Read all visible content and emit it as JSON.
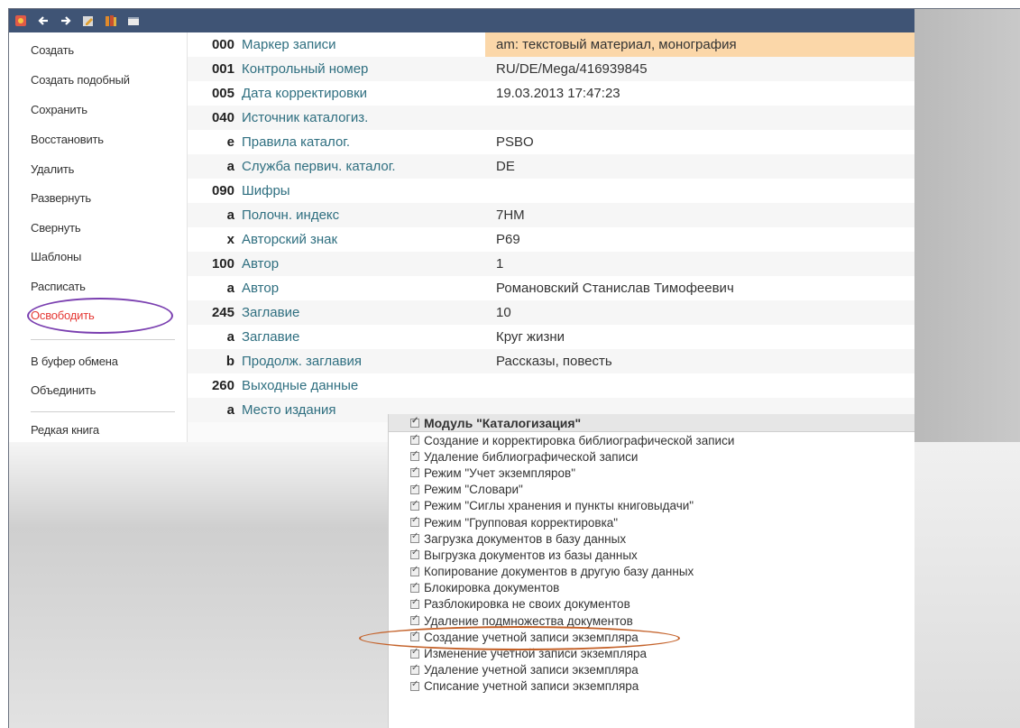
{
  "toolbar": {
    "icons": [
      "app-logo-icon",
      "back-arrow-icon",
      "forward-arrow-icon",
      "edit-icon",
      "books-icon",
      "window-icon"
    ]
  },
  "sidebar": {
    "items": [
      {
        "label": "Создать"
      },
      {
        "label": "Создать подобный"
      },
      {
        "label": "Сохранить"
      },
      {
        "label": "Восстановить"
      },
      {
        "label": "Удалить"
      },
      {
        "label": "Развернуть"
      },
      {
        "label": "Свернуть"
      },
      {
        "label": "Шаблоны"
      },
      {
        "label": "Расписать"
      },
      {
        "label": "Освободить"
      },
      {
        "label": "В буфер обмена"
      },
      {
        "label": "Объединить"
      },
      {
        "label": "Редкая книга"
      }
    ],
    "highlight_color": "#e53935"
  },
  "record": {
    "rows": [
      {
        "code": "000",
        "label": "Маркер записи",
        "value": "am: текстовый материал, монография"
      },
      {
        "code": "001",
        "label": "Контрольный номер",
        "value": "RU/DE/Mega/416939845"
      },
      {
        "code": "005",
        "label": "Дата корректировки",
        "value": "19.03.2013 17:47:23"
      },
      {
        "code": "040",
        "label": "Источник каталогиз.",
        "value": ""
      },
      {
        "code": "e",
        "label": "Правила каталог.",
        "value": "PSBO"
      },
      {
        "code": "a",
        "label": "Служба первич. каталог.",
        "value": "DE"
      },
      {
        "code": "090",
        "label": "Шифры",
        "value": ""
      },
      {
        "code": "a",
        "label": "Полочн. индекс",
        "value": "7HM"
      },
      {
        "code": "x",
        "label": "Авторский знак",
        "value": "P69"
      },
      {
        "code": "100",
        "label": "Автор",
        "value": "1"
      },
      {
        "code": "a",
        "label": "Автор",
        "value": "Романовский Станислав Тимофеевич"
      },
      {
        "code": "245",
        "label": "Заглавие",
        "value": "10"
      },
      {
        "code": "a",
        "label": "Заглавие",
        "value": "Круг жизни"
      },
      {
        "code": "b",
        "label": "Продолж. заглавия",
        "value": "Рассказы, повесть"
      },
      {
        "code": "260",
        "label": "Выходные данные",
        "value": ""
      },
      {
        "code": "a",
        "label": "Место издания",
        "value": ""
      }
    ],
    "highlight_color": "#fbd7a9"
  },
  "permissions": {
    "header": "Модуль \"Каталогизация\"",
    "items": [
      "Создание и корректировка библиографической записи",
      "Удаление библиографической записи",
      "Режим \"Учет экземпляров\"",
      "Режим \"Словари\"",
      "Режим \"Сиглы хранения и пункты книговыдачи\"",
      "Режим \"Групповая корректировка\"",
      "Загрузка документов в базу данных",
      "Выгрузка документов из базы данных",
      "Копирование документов в другую базу данных",
      "Блокировка документов",
      "Разблокировка не своих документов",
      "Удаление подмножества документов",
      "Создание учетной записи экземпляра",
      "Изменение учетной записи экземпляра",
      "Удаление учетной записи экземпляра",
      "Списание учетной записи экземпляра"
    ]
  },
  "annotations": {
    "purple_color": "#7a3fb0",
    "orange_color": "#c4622a"
  }
}
